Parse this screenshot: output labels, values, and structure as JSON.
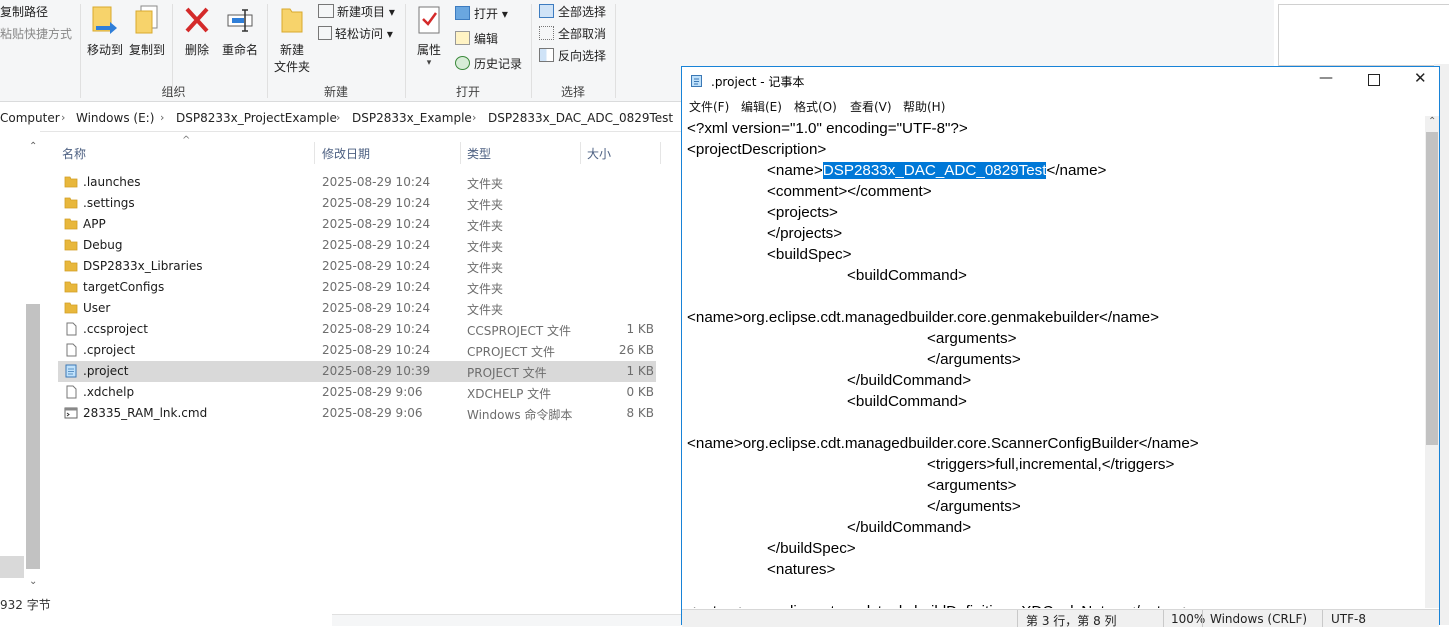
{
  "ribbon": {
    "copy_path": "复制路径",
    "paste_shortcut": "粘贴快捷方式",
    "move_to": "移动到",
    "copy_to": "复制到",
    "delete": "删除",
    "rename": "重命名",
    "organize_group": "组织",
    "new_folder_line1": "新建",
    "new_folder_line2": "文件夹",
    "new_item": "新建项目",
    "easy_access": "轻松访问",
    "new_group": "新建",
    "properties": "属性",
    "open": "打开",
    "edit": "编辑",
    "history": "历史记录",
    "open_group": "打开",
    "select_all": "全部选择",
    "select_none": "全部取消",
    "invert_selection": "反向选择",
    "select_group": "选择"
  },
  "breadcrumb": [
    "Computer",
    "Windows (E:)",
    "DSP8233x_ProjectExample",
    "DSP2833x_Example",
    "DSP2833x_DAC_ADC_0829Test"
  ],
  "columns": {
    "name": "名称",
    "date": "修改日期",
    "type": "类型",
    "size": "大小"
  },
  "files": [
    {
      "name": ".launches",
      "date": "2025-08-29 10:24",
      "type": "文件夹",
      "size": "",
      "kind": "folder"
    },
    {
      "name": ".settings",
      "date": "2025-08-29 10:24",
      "type": "文件夹",
      "size": "",
      "kind": "folder"
    },
    {
      "name": "APP",
      "date": "2025-08-29 10:24",
      "type": "文件夹",
      "size": "",
      "kind": "folder"
    },
    {
      "name": "Debug",
      "date": "2025-08-29 10:24",
      "type": "文件夹",
      "size": "",
      "kind": "folder"
    },
    {
      "name": "DSP2833x_Libraries",
      "date": "2025-08-29 10:24",
      "type": "文件夹",
      "size": "",
      "kind": "folder"
    },
    {
      "name": "targetConfigs",
      "date": "2025-08-29 10:24",
      "type": "文件夹",
      "size": "",
      "kind": "folder"
    },
    {
      "name": "User",
      "date": "2025-08-29 10:24",
      "type": "文件夹",
      "size": "",
      "kind": "folder"
    },
    {
      "name": ".ccsproject",
      "date": "2025-08-29 10:24",
      "type": "CCSPROJECT 文件",
      "size": "1 KB",
      "kind": "file"
    },
    {
      "name": ".cproject",
      "date": "2025-08-29 10:24",
      "type": "CPROJECT 文件",
      "size": "26 KB",
      "kind": "file"
    },
    {
      "name": ".project",
      "date": "2025-08-29 10:39",
      "type": "PROJECT 文件",
      "size": "1 KB",
      "kind": "file-selected"
    },
    {
      "name": ".xdchelp",
      "date": "2025-08-29 9:06",
      "type": "XDCHELP 文件",
      "size": "0 KB",
      "kind": "file"
    },
    {
      "name": "28335_RAM_lnk.cmd",
      "date": "2025-08-29 9:06",
      "type": "Windows 命令脚本",
      "size": "8 KB",
      "kind": "cmd"
    }
  ],
  "status_bar": "932 字节",
  "notepad": {
    "title": ".project - 记事本",
    "menu": [
      "文件(F)",
      "编辑(E)",
      "格式(O)",
      "查看(V)",
      "帮助(H)"
    ],
    "lines": [
      "<?xml version=\"1.0\" encoding=\"UTF-8\"?>",
      "<projectDescription>",
      "\t<name>",
      "\t<comment></comment>",
      "\t<projects>",
      "\t</projects>",
      "\t<buildSpec>",
      "\t\t<buildCommand>",
      "",
      "<name>org.eclipse.cdt.managedbuilder.core.genmakebuilder</name>",
      "\t\t\t<arguments>",
      "\t\t\t</arguments>",
      "\t\t</buildCommand>",
      "\t\t<buildCommand>",
      "",
      "<name>org.eclipse.cdt.managedbuilder.core.ScannerConfigBuilder</name>",
      "\t\t\t<triggers>full,incremental,</triggers>",
      "\t\t\t<arguments>",
      "\t\t\t</arguments>",
      "\t\t</buildCommand>",
      "\t</buildSpec>",
      "\t<natures>",
      "",
      "<nature>org.eclipse.rtsc.xdctools.buildDefinitions.XDC.xdcNature</nature>"
    ],
    "selected_text": "DSP2833x_DAC_ADC_0829Test",
    "name_close": "</name>",
    "status": {
      "position": "第 3 行，第 8 列",
      "zoom": "100%",
      "line_ending": "Windows (CRLF)",
      "encoding": "UTF-8"
    }
  },
  "colors": {
    "accent": "#0078d7",
    "folder": "#e8b73c",
    "delete_red": "#d42a2a"
  }
}
